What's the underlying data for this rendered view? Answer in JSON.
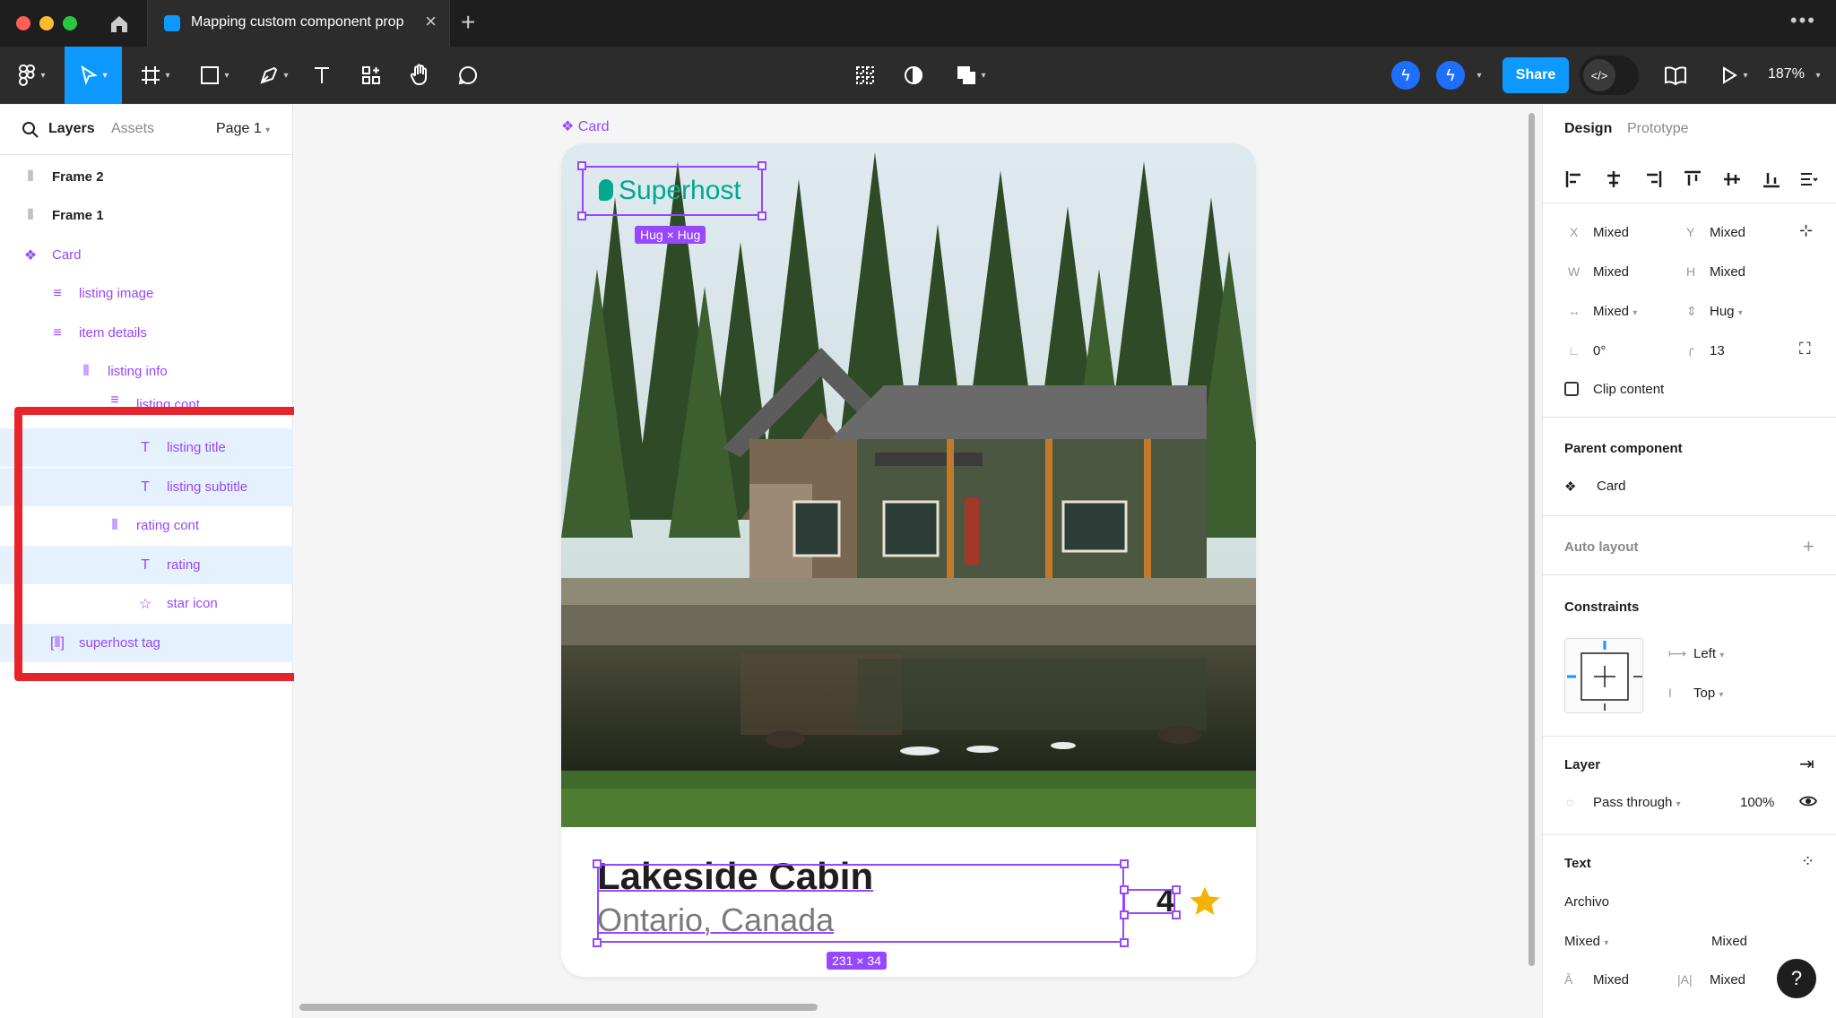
{
  "tab": {
    "title": "Mapping custom component prop"
  },
  "toolbar": {
    "share_label": "Share",
    "zoom": "187%"
  },
  "left_panel": {
    "tabs": {
      "layers": "Layers",
      "assets": "Assets"
    },
    "page": "Page 1",
    "layers": [
      {
        "label": "Frame 2"
      },
      {
        "label": "Frame 1"
      },
      {
        "label": "Card"
      },
      {
        "label": "listing image"
      },
      {
        "label": "item details"
      },
      {
        "label": "listing info"
      },
      {
        "label": "listing cont"
      },
      {
        "label": "listing title"
      },
      {
        "label": "listing subtitle"
      },
      {
        "label": "rating cont"
      },
      {
        "label": "rating"
      },
      {
        "label": "star icon"
      },
      {
        "label": "superhost tag"
      }
    ]
  },
  "canvas": {
    "card_label": "Card",
    "superhost_text": "Superhost",
    "hug_badge": "Hug × Hug",
    "listing_title": "Lakeside Cabin",
    "listing_subtitle": "Ontario, Canada",
    "rating_value": "4",
    "size_badge": "231 × 34"
  },
  "right_panel": {
    "tabs": {
      "design": "Design",
      "prototype": "Prototype"
    },
    "x_label": "X",
    "x_value": "Mixed",
    "y_label": "Y",
    "y_value": "Mixed",
    "w_label": "W",
    "w_value": "Mixed",
    "h_label": "H",
    "h_value": "Mixed",
    "horizontal_resize": "Mixed",
    "vertical_resize": "Hug",
    "rotation": "0°",
    "corner_radius": "13",
    "clip_content": "Clip content",
    "parent_component_title": "Parent component",
    "parent_component_name": "Card",
    "auto_layout_title": "Auto layout",
    "constraints_title": "Constraints",
    "constraint_horizontal": "Left",
    "constraint_vertical": "Top",
    "layer_title": "Layer",
    "blend_mode": "Pass through",
    "opacity": "100%",
    "text_title": "Text",
    "font_family": "Archivo",
    "font_style": "Mixed",
    "font_size": "Mixed",
    "line_height": "Mixed",
    "letter_spacing": "Mixed"
  },
  "colors": {
    "accent": "#0d99ff",
    "component_purple": "#9747ff",
    "highlight_red": "#e8232a",
    "superhost_green": "#00a88e",
    "star_yellow": "#f5b301"
  },
  "icons": [
    "home-icon",
    "figma-file-icon",
    "close-icon",
    "plus-icon",
    "main-menu-icon",
    "move-tool-icon",
    "frame-tool-icon",
    "shape-tool-icon",
    "pen-tool-icon",
    "text-tool-icon",
    "resources-icon",
    "hand-tool-icon",
    "comment-tool-icon",
    "component-icon",
    "contrast-icon",
    "boolean-icon",
    "lightning-icon",
    "code-icon",
    "book-icon",
    "play-icon",
    "search-icon",
    "star-icon",
    "eye-icon",
    "help-icon"
  ]
}
